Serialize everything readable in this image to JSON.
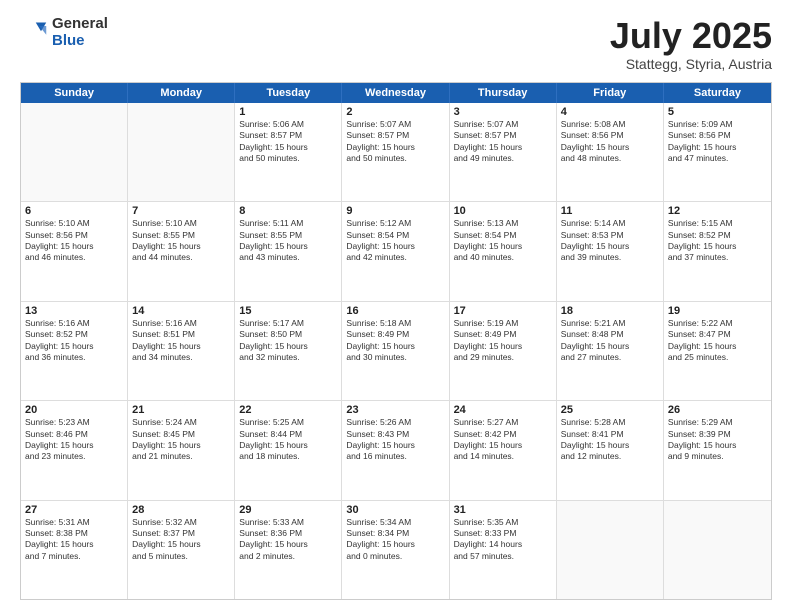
{
  "logo": {
    "general": "General",
    "blue": "Blue"
  },
  "title": "July 2025",
  "location": "Stattegg, Styria, Austria",
  "days_of_week": [
    "Sunday",
    "Monday",
    "Tuesday",
    "Wednesday",
    "Thursday",
    "Friday",
    "Saturday"
  ],
  "weeks": [
    [
      {
        "day": "",
        "lines": []
      },
      {
        "day": "",
        "lines": []
      },
      {
        "day": "1",
        "lines": [
          "Sunrise: 5:06 AM",
          "Sunset: 8:57 PM",
          "Daylight: 15 hours",
          "and 50 minutes."
        ]
      },
      {
        "day": "2",
        "lines": [
          "Sunrise: 5:07 AM",
          "Sunset: 8:57 PM",
          "Daylight: 15 hours",
          "and 50 minutes."
        ]
      },
      {
        "day": "3",
        "lines": [
          "Sunrise: 5:07 AM",
          "Sunset: 8:57 PM",
          "Daylight: 15 hours",
          "and 49 minutes."
        ]
      },
      {
        "day": "4",
        "lines": [
          "Sunrise: 5:08 AM",
          "Sunset: 8:56 PM",
          "Daylight: 15 hours",
          "and 48 minutes."
        ]
      },
      {
        "day": "5",
        "lines": [
          "Sunrise: 5:09 AM",
          "Sunset: 8:56 PM",
          "Daylight: 15 hours",
          "and 47 minutes."
        ]
      }
    ],
    [
      {
        "day": "6",
        "lines": [
          "Sunrise: 5:10 AM",
          "Sunset: 8:56 PM",
          "Daylight: 15 hours",
          "and 46 minutes."
        ]
      },
      {
        "day": "7",
        "lines": [
          "Sunrise: 5:10 AM",
          "Sunset: 8:55 PM",
          "Daylight: 15 hours",
          "and 44 minutes."
        ]
      },
      {
        "day": "8",
        "lines": [
          "Sunrise: 5:11 AM",
          "Sunset: 8:55 PM",
          "Daylight: 15 hours",
          "and 43 minutes."
        ]
      },
      {
        "day": "9",
        "lines": [
          "Sunrise: 5:12 AM",
          "Sunset: 8:54 PM",
          "Daylight: 15 hours",
          "and 42 minutes."
        ]
      },
      {
        "day": "10",
        "lines": [
          "Sunrise: 5:13 AM",
          "Sunset: 8:54 PM",
          "Daylight: 15 hours",
          "and 40 minutes."
        ]
      },
      {
        "day": "11",
        "lines": [
          "Sunrise: 5:14 AM",
          "Sunset: 8:53 PM",
          "Daylight: 15 hours",
          "and 39 minutes."
        ]
      },
      {
        "day": "12",
        "lines": [
          "Sunrise: 5:15 AM",
          "Sunset: 8:52 PM",
          "Daylight: 15 hours",
          "and 37 minutes."
        ]
      }
    ],
    [
      {
        "day": "13",
        "lines": [
          "Sunrise: 5:16 AM",
          "Sunset: 8:52 PM",
          "Daylight: 15 hours",
          "and 36 minutes."
        ]
      },
      {
        "day": "14",
        "lines": [
          "Sunrise: 5:16 AM",
          "Sunset: 8:51 PM",
          "Daylight: 15 hours",
          "and 34 minutes."
        ]
      },
      {
        "day": "15",
        "lines": [
          "Sunrise: 5:17 AM",
          "Sunset: 8:50 PM",
          "Daylight: 15 hours",
          "and 32 minutes."
        ]
      },
      {
        "day": "16",
        "lines": [
          "Sunrise: 5:18 AM",
          "Sunset: 8:49 PM",
          "Daylight: 15 hours",
          "and 30 minutes."
        ]
      },
      {
        "day": "17",
        "lines": [
          "Sunrise: 5:19 AM",
          "Sunset: 8:49 PM",
          "Daylight: 15 hours",
          "and 29 minutes."
        ]
      },
      {
        "day": "18",
        "lines": [
          "Sunrise: 5:21 AM",
          "Sunset: 8:48 PM",
          "Daylight: 15 hours",
          "and 27 minutes."
        ]
      },
      {
        "day": "19",
        "lines": [
          "Sunrise: 5:22 AM",
          "Sunset: 8:47 PM",
          "Daylight: 15 hours",
          "and 25 minutes."
        ]
      }
    ],
    [
      {
        "day": "20",
        "lines": [
          "Sunrise: 5:23 AM",
          "Sunset: 8:46 PM",
          "Daylight: 15 hours",
          "and 23 minutes."
        ]
      },
      {
        "day": "21",
        "lines": [
          "Sunrise: 5:24 AM",
          "Sunset: 8:45 PM",
          "Daylight: 15 hours",
          "and 21 minutes."
        ]
      },
      {
        "day": "22",
        "lines": [
          "Sunrise: 5:25 AM",
          "Sunset: 8:44 PM",
          "Daylight: 15 hours",
          "and 18 minutes."
        ]
      },
      {
        "day": "23",
        "lines": [
          "Sunrise: 5:26 AM",
          "Sunset: 8:43 PM",
          "Daylight: 15 hours",
          "and 16 minutes."
        ]
      },
      {
        "day": "24",
        "lines": [
          "Sunrise: 5:27 AM",
          "Sunset: 8:42 PM",
          "Daylight: 15 hours",
          "and 14 minutes."
        ]
      },
      {
        "day": "25",
        "lines": [
          "Sunrise: 5:28 AM",
          "Sunset: 8:41 PM",
          "Daylight: 15 hours",
          "and 12 minutes."
        ]
      },
      {
        "day": "26",
        "lines": [
          "Sunrise: 5:29 AM",
          "Sunset: 8:39 PM",
          "Daylight: 15 hours",
          "and 9 minutes."
        ]
      }
    ],
    [
      {
        "day": "27",
        "lines": [
          "Sunrise: 5:31 AM",
          "Sunset: 8:38 PM",
          "Daylight: 15 hours",
          "and 7 minutes."
        ]
      },
      {
        "day": "28",
        "lines": [
          "Sunrise: 5:32 AM",
          "Sunset: 8:37 PM",
          "Daylight: 15 hours",
          "and 5 minutes."
        ]
      },
      {
        "day": "29",
        "lines": [
          "Sunrise: 5:33 AM",
          "Sunset: 8:36 PM",
          "Daylight: 15 hours",
          "and 2 minutes."
        ]
      },
      {
        "day": "30",
        "lines": [
          "Sunrise: 5:34 AM",
          "Sunset: 8:34 PM",
          "Daylight: 15 hours",
          "and 0 minutes."
        ]
      },
      {
        "day": "31",
        "lines": [
          "Sunrise: 5:35 AM",
          "Sunset: 8:33 PM",
          "Daylight: 14 hours",
          "and 57 minutes."
        ]
      },
      {
        "day": "",
        "lines": []
      },
      {
        "day": "",
        "lines": []
      }
    ]
  ]
}
